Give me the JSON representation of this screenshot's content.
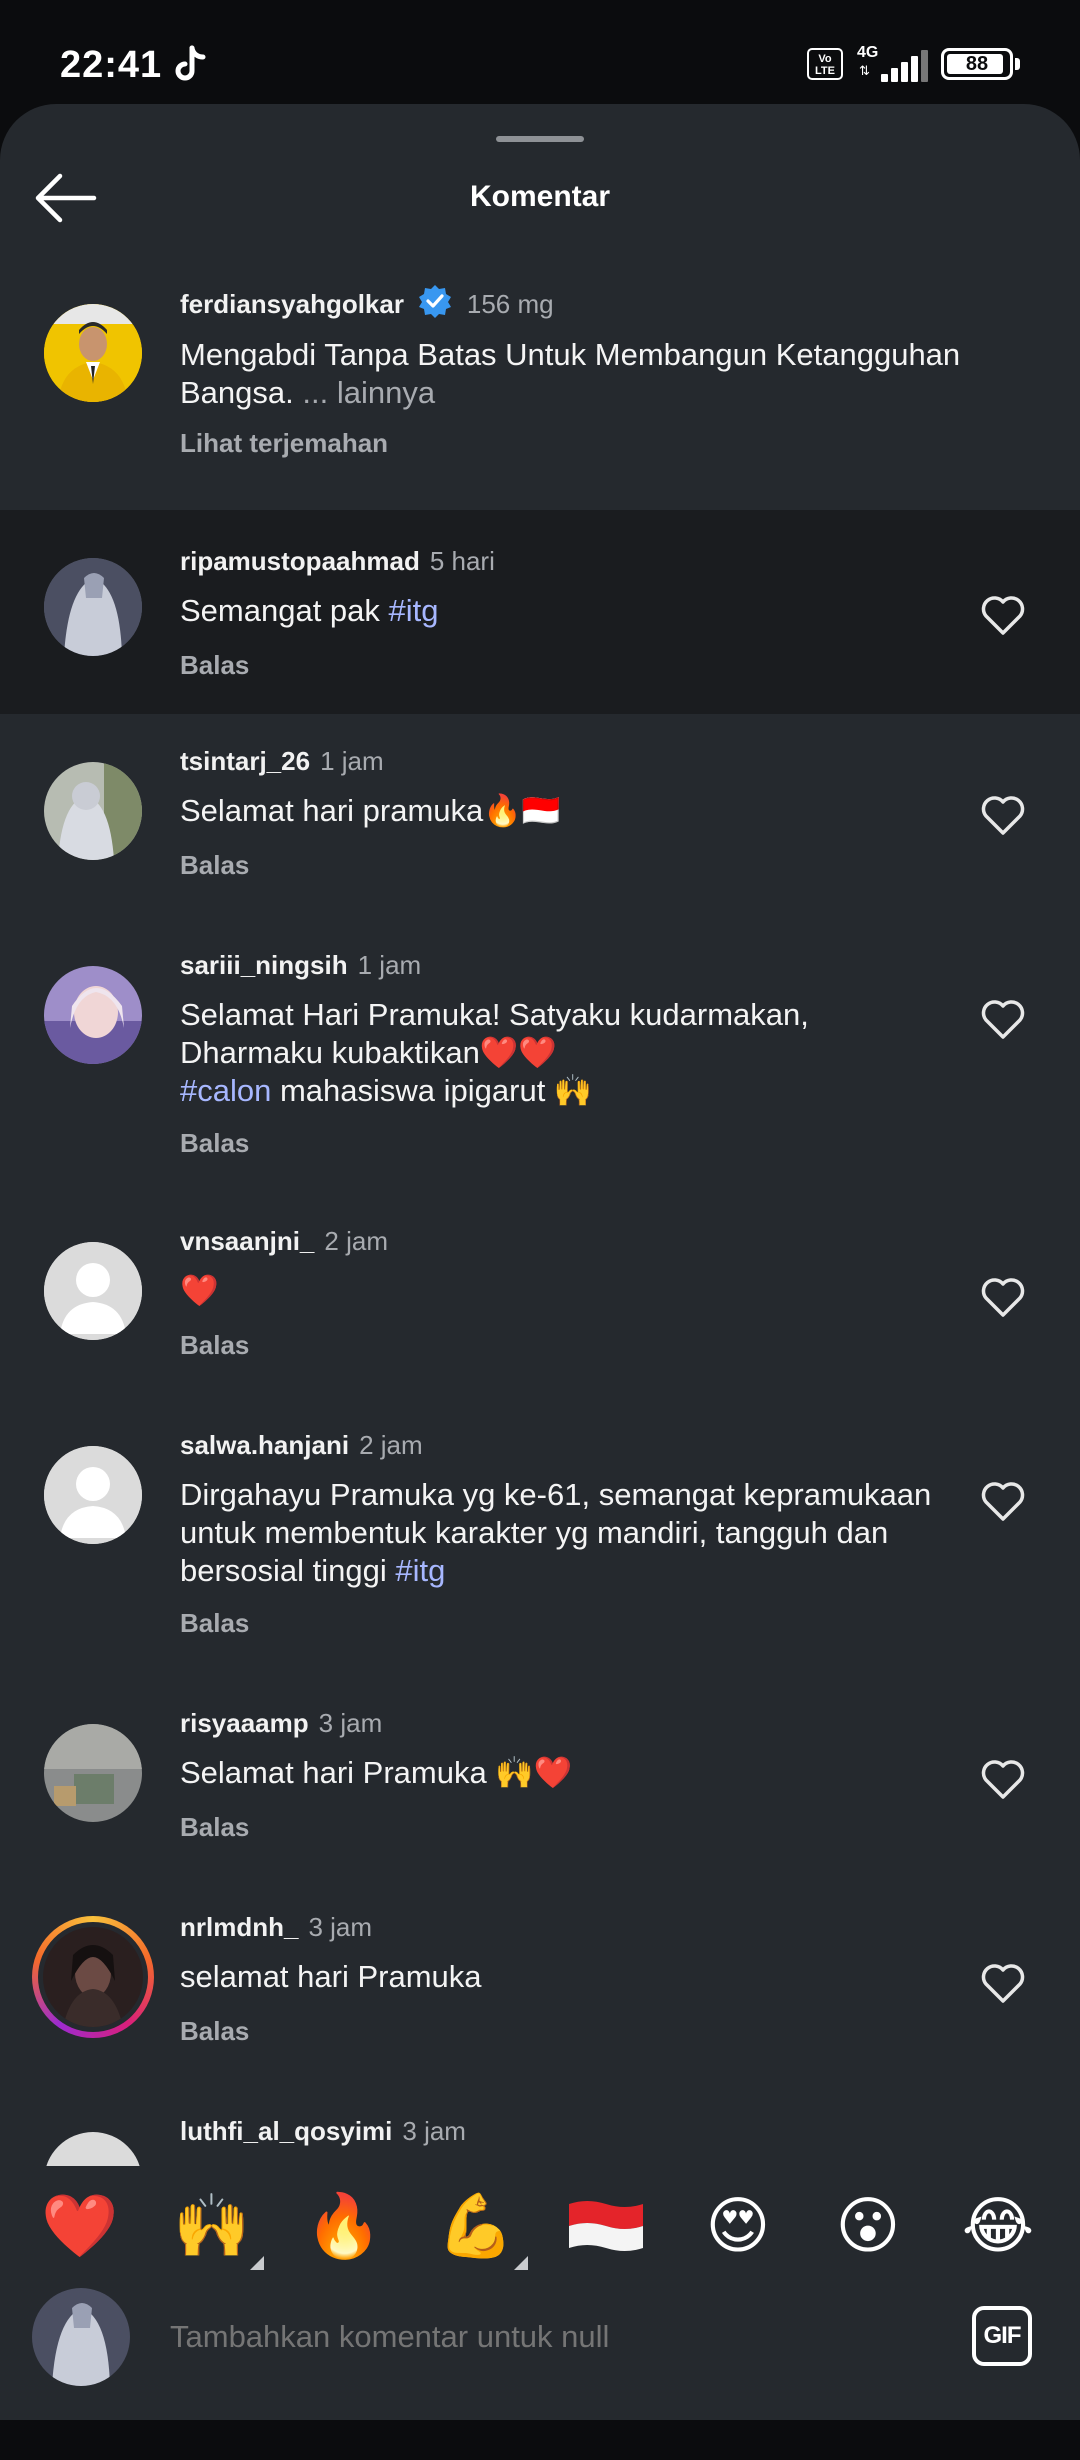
{
  "status_bar": {
    "time": "22:41",
    "network": "4G",
    "volte": "Vo LTE",
    "battery": "88"
  },
  "header": {
    "title": "Komentar"
  },
  "caption": {
    "username": "ferdiansyahgolkar",
    "time": "156 mg",
    "text": "Mengabdi Tanpa Batas Untuk Membangun Ketangguhan Bangsa.",
    "more": "... lainnya",
    "translate": "Lihat terjemahan"
  },
  "comments": [
    {
      "username": "ripamustopaahmad",
      "time": "5 hari",
      "text": "Semangat pak ",
      "hashtag": "#itg",
      "reply": "Balas"
    },
    {
      "username": "tsintarj_26",
      "time": "1 jam",
      "text": "Selamat hari pramuka🔥🇮🇩",
      "reply": "Balas"
    },
    {
      "username": "sariii_ningsih",
      "time": "1 jam",
      "text_line1": "Selamat Hari Pramuka! Satyaku kudarmakan,",
      "text_line2": "Dharmaku kubaktikan❤️❤️",
      "hashtag": "#calon",
      "text_line3": " mahasiswa ipigarut 🙌",
      "reply": "Balas"
    },
    {
      "username": "vnsaanjni_",
      "time": "2 jam",
      "text": "❤️",
      "reply": "Balas"
    },
    {
      "username": "salwa.hanjani",
      "time": "2 jam",
      "text_line1": "Dirgahayu Pramuka yg ke-61, semangat kepramukaan",
      "text_line2": "untuk membentuk karakter yg mandiri, tangguh dan",
      "text_line3": "bersosial tinggi ",
      "hashtag": "#itg",
      "reply": "Balas"
    },
    {
      "username": "risyaaamp",
      "time": "3 jam",
      "text": "Selamat hari Pramuka 🙌❤️",
      "reply": "Balas"
    },
    {
      "username": "nrlmdnh_",
      "time": "3 jam",
      "text": "selamat hari Pramuka",
      "reply": "Balas"
    },
    {
      "username": "luthfi_al_qosyimi",
      "time": "3 jam"
    }
  ],
  "emoji_bar": [
    "❤️",
    "🙌",
    "🔥",
    "💪",
    "🇮🇩",
    "😍",
    "😮",
    "😂"
  ],
  "composer": {
    "placeholder": "Tambahkan komentar untuk null",
    "gif_label": "GIF"
  },
  "colors": {
    "sheet_bg": "#25292e",
    "highlight_bg": "#1a1c1f",
    "hashtag": "#a7b7ff",
    "verified": "#3897f0"
  }
}
